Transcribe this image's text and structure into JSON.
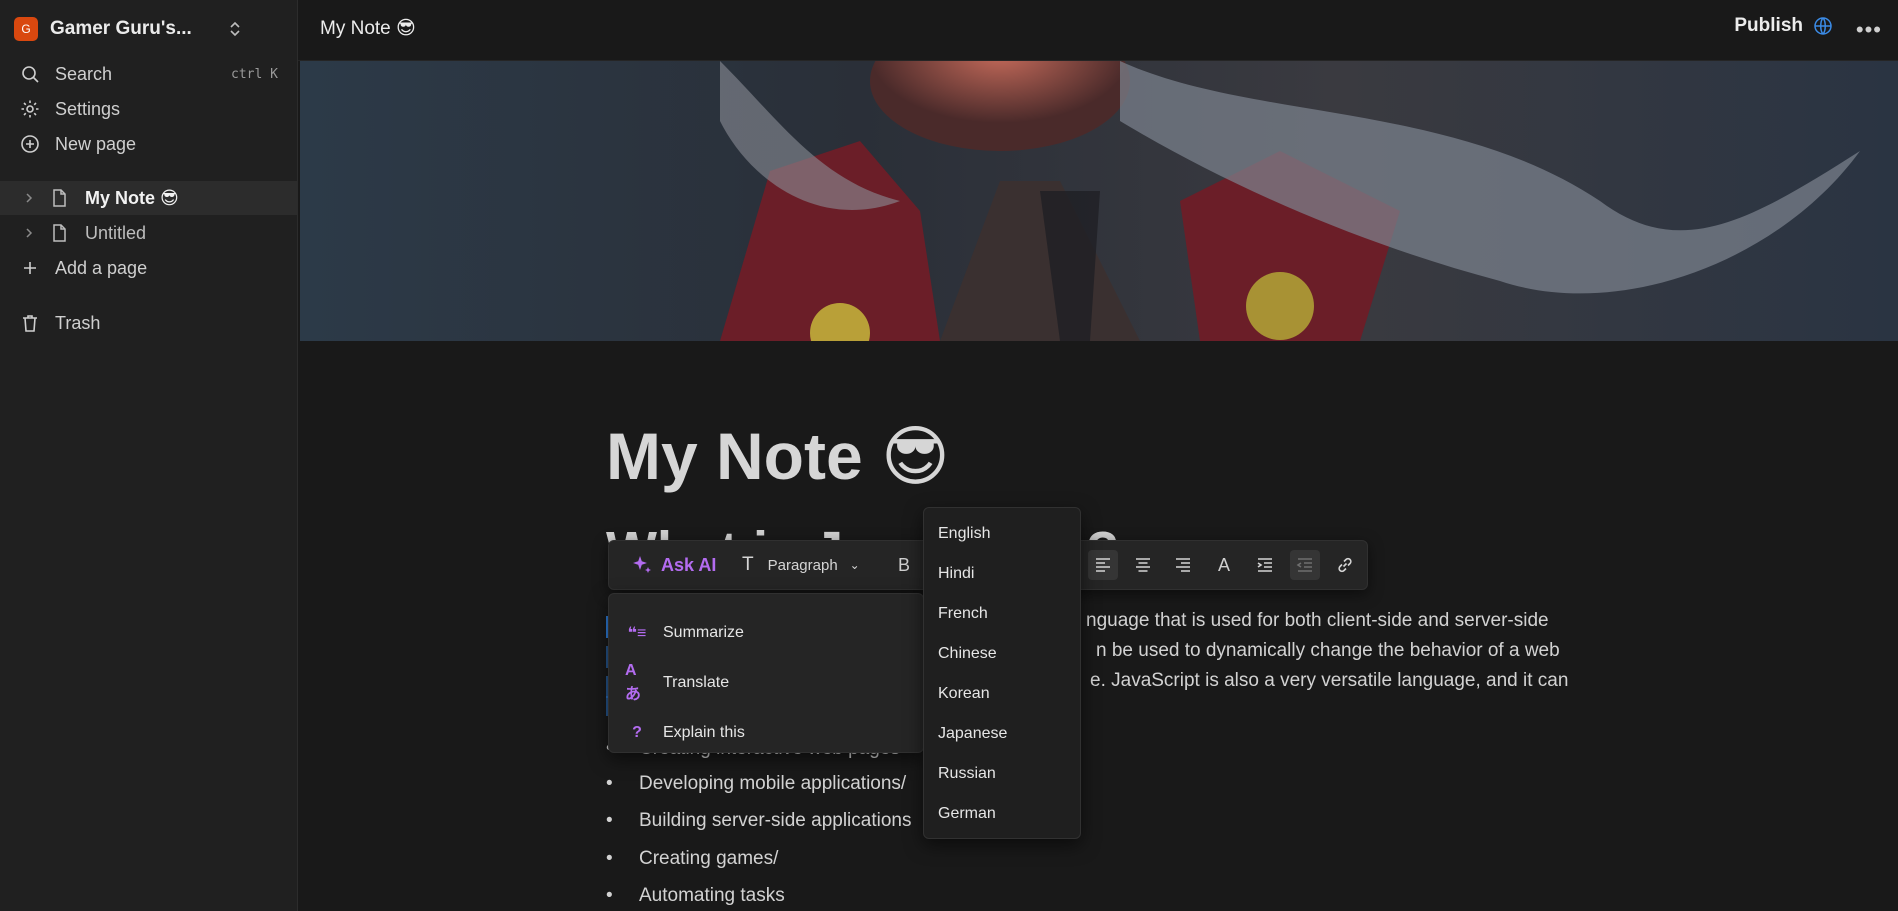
{
  "sidebar": {
    "workspace": {
      "avatar_letter": "G",
      "name": "Gamer Guru's...",
      "avatar_color": "#d9480f"
    },
    "search": {
      "label": "Search",
      "shortcut": "ctrl K"
    },
    "settings": {
      "label": "Settings"
    },
    "new_page": {
      "label": "New page"
    },
    "pages": [
      {
        "label": "My Note 😎",
        "active": true
      },
      {
        "label": "Untitled",
        "active": false
      }
    ],
    "add_page": {
      "label": "Add a page"
    },
    "trash": {
      "label": "Trash"
    }
  },
  "topbar": {
    "title": "My Note 😎",
    "publish_label": "Publish"
  },
  "document": {
    "title": "My Note 😎",
    "heading_partial": "What is JavaScript?",
    "paragraph_lines": [
      "nguage that is used for both client-side and server-side",
      "n be used to dynamically change the behavior of a web",
      "e. JavaScript is also a very versatile language, and it can"
    ],
    "bullets": [
      "Creating interactive web pages",
      "Developing mobile applications/",
      "Building server-side applications",
      "Creating games/",
      "Automating tasks"
    ]
  },
  "toolbar": {
    "ask_ai": "Ask AI",
    "block_type": "Paragraph",
    "bold": "B",
    "text_color": "A",
    "accent": "#b36cf0"
  },
  "ai_menu": {
    "items": [
      {
        "icon": "quote-icon",
        "label": "Summarize"
      },
      {
        "icon": "translate-icon",
        "label": "Translate"
      },
      {
        "icon": "question-icon",
        "label": "Explain this"
      }
    ]
  },
  "language_menu": {
    "languages": [
      "English",
      "Hindi",
      "French",
      "Chinese",
      "Korean",
      "Japanese",
      "Russian",
      "German"
    ]
  }
}
